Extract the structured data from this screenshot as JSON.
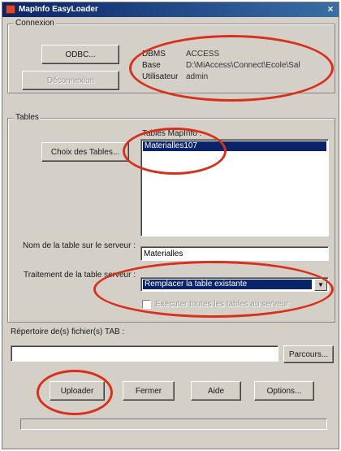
{
  "window": {
    "title": "MapInfo EasyLoader",
    "close_glyph": "×"
  },
  "connexion": {
    "group_label": "Connexion",
    "odbc_button": "ODBC...",
    "disconnect_button": "Déconnexion",
    "dbms_label": "DBMS",
    "dbms_value": "ACCESS",
    "base_label": "Base",
    "base_value": "D:\\MiAccess\\Connect\\Ecole\\Sal",
    "user_label": "Utilisateur",
    "user_value": "admin"
  },
  "tables": {
    "group_label": "Tables",
    "choose_button": "Choix des Tables...",
    "list_label": "Tables MapInfo :",
    "items": [
      "Materialles107"
    ],
    "server_name_label": "Nom de la table sur le serveur :",
    "server_name_value": "Materialles",
    "treatment_label": "Traitement de la table serveur :",
    "treatment_value": "Remplacer la table existante",
    "checkbox_label": "Exécuter toutes les tables au serveur"
  },
  "repertoire": {
    "label": "Répertoire de(s) fichier(s) TAB :",
    "value": "",
    "browse_button": "Parcours..."
  },
  "actions": {
    "upload": "Uploader",
    "close": "Fermer",
    "help": "Aide",
    "options": "Options..."
  },
  "progress": {
    "value": 0
  },
  "colors": {
    "annotation_red": "#d9301c",
    "selection_blue": "#0a246a",
    "dialog_gray": "#d4d0c8"
  },
  "icons": {
    "app": "mapinfo-app-icon",
    "close": "close-icon",
    "dropdown": "chevron-down-icon"
  }
}
